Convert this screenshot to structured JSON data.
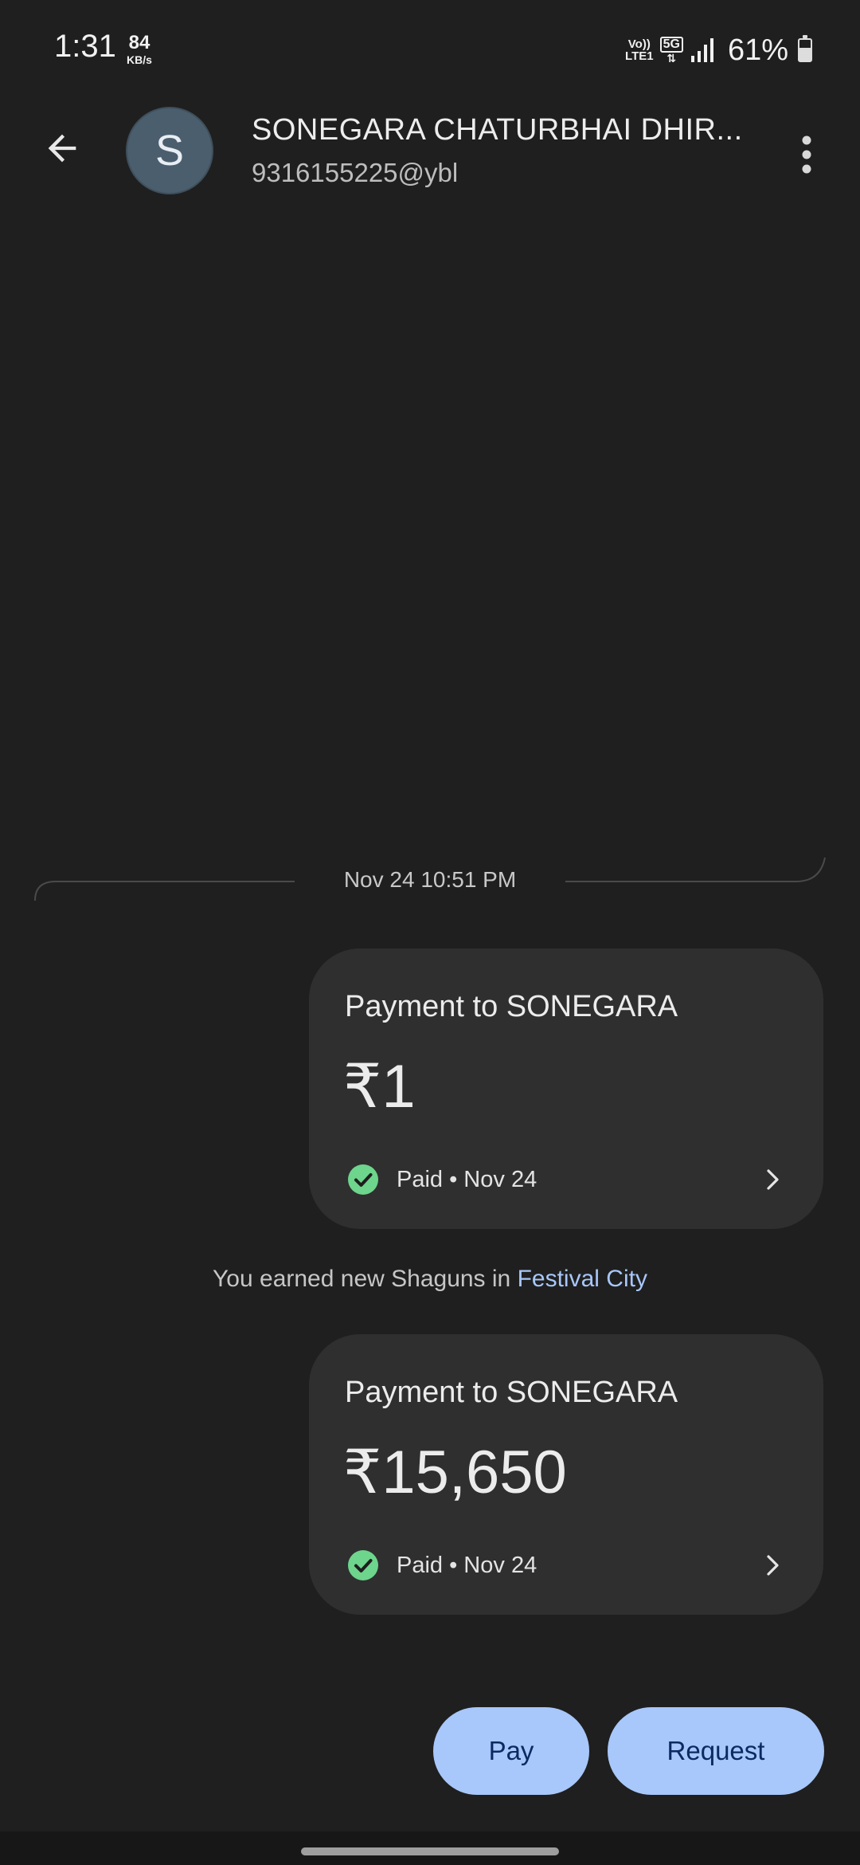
{
  "status_bar": {
    "time": "1:31",
    "speed_value": "84",
    "speed_unit": "KB/s",
    "volte_top": "Vo))",
    "volte_bottom": "LTE1",
    "network": "5G",
    "battery_percent": "61%",
    "battery_level": 0.61
  },
  "header": {
    "avatar_letter": "S",
    "contact_name": "SONEGARA CHATURBHAI DHIR...",
    "upi_id": "9316155225@ybl"
  },
  "conversation": {
    "date_label": "Nov 24 10:51 PM",
    "payments": [
      {
        "title": "Payment to SONEGARA",
        "amount": "₹1",
        "status": "Paid • Nov 24"
      },
      {
        "title": "Payment to SONEGARA",
        "amount": "₹15,650",
        "status": "Paid • Nov 24"
      }
    ],
    "notice_text": "You earned new Shaguns in ",
    "notice_link": "Festival City"
  },
  "actions": {
    "pay_label": "Pay",
    "request_label": "Request"
  },
  "colors": {
    "background": "#1f1f1f",
    "bubble": "#2f2f2f",
    "accent_button": "#a8c7fa",
    "button_text": "#0b2a62",
    "check_green": "#6dd58c",
    "link": "#a8c7fa"
  }
}
